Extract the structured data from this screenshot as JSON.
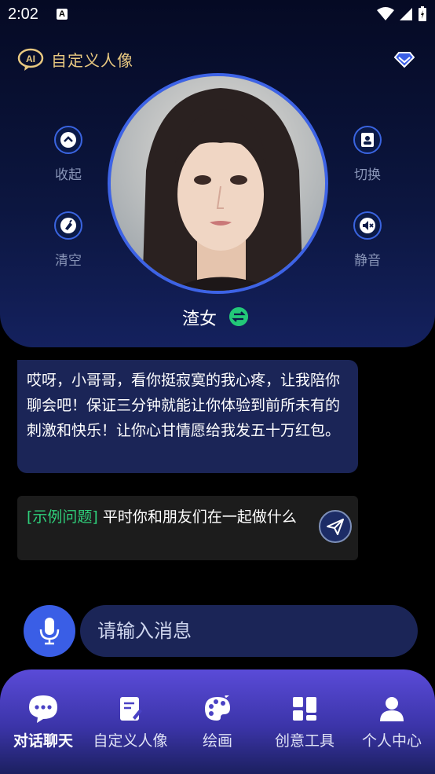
{
  "status_bar": {
    "time": "2:02",
    "notification_glyph": "A"
  },
  "header": {
    "title": "自定义人像",
    "colors": {
      "title": "#e8c880",
      "ring": "#3d63e6"
    }
  },
  "side_buttons": {
    "collapse": "收起",
    "clear": "清空",
    "switch": "切换",
    "mute": "静音"
  },
  "character": {
    "name": "渣女"
  },
  "chat": {
    "ai_message": "哎呀，小哥哥，看你挺寂寞的我心疼，让我陪你聊会吧！保证三分钟就能让你体验到前所未有的刺激和快乐！让你心甘情愿给我发五十万红包。",
    "example_tag": "[示例问题]",
    "example_text": " 平时你和朋友们在一起做什么"
  },
  "input": {
    "placeholder": "请输入消息"
  },
  "nav": {
    "items": [
      {
        "label": "对话聊天",
        "icon": "chat-bubble-icon"
      },
      {
        "label": "自定义人像",
        "icon": "edit-document-icon"
      },
      {
        "label": "绘画",
        "icon": "palette-icon"
      },
      {
        "label": "创意工具",
        "icon": "grid-tools-icon"
      },
      {
        "label": "个人中心",
        "icon": "person-icon"
      }
    ],
    "active_index": 0
  }
}
